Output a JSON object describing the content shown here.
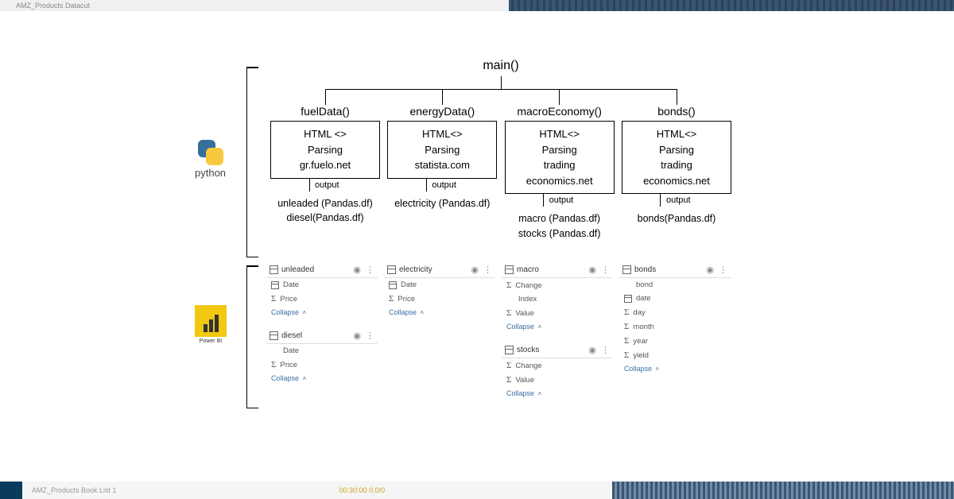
{
  "topbar": {
    "hint": "AMZ_Products Datacut"
  },
  "bottombar": {
    "label": "AMZ_Products Book List 1",
    "time": "00:30:00      0.0/0"
  },
  "tools": {
    "python": "python",
    "powerbi": "Power BI"
  },
  "diagram": {
    "main": "main()",
    "outputLabel": "output",
    "cols": [
      {
        "fn": "fuelData()",
        "box": [
          "HTML <>",
          "Parsing",
          "gr.fuelo.net"
        ],
        "outputs": [
          "unleaded (Pandas.df)",
          "diesel(Pandas.df)"
        ]
      },
      {
        "fn": "energyData()",
        "box": [
          "HTML<>",
          "Parsing",
          "statista.com"
        ],
        "outputs": [
          "electricity (Pandas.df)"
        ]
      },
      {
        "fn": "macroEconomy()",
        "box": [
          "HTML<>",
          "Parsing",
          "trading",
          "economics.net"
        ],
        "outputs": [
          "macro (Pandas.df)",
          "stocks (Pandas.df)"
        ]
      },
      {
        "fn": "bonds()",
        "box": [
          "HTML<>",
          "Parsing",
          "trading",
          "economics.net"
        ],
        "outputs": [
          "bonds(Pandas.df)"
        ]
      }
    ]
  },
  "tables": {
    "collapse": "Collapse",
    "eye": "◉",
    "more": "⋮",
    "cards": {
      "unleaded": {
        "name": "unleaded",
        "fields": [
          {
            "t": "cal",
            "n": "Date"
          },
          {
            "t": "sigma",
            "n": "Price"
          }
        ]
      },
      "diesel": {
        "name": "diesel",
        "fields": [
          {
            "t": "none",
            "n": "Date"
          },
          {
            "t": "sigma",
            "n": "Price"
          }
        ]
      },
      "electricity": {
        "name": "electricity",
        "fields": [
          {
            "t": "cal",
            "n": "Date"
          },
          {
            "t": "sigma",
            "n": "Price"
          }
        ]
      },
      "macro": {
        "name": "macro",
        "fields": [
          {
            "t": "sigma",
            "n": "Change"
          },
          {
            "t": "none",
            "n": "Index"
          },
          {
            "t": "sigma",
            "n": "Value"
          }
        ]
      },
      "stocks": {
        "name": "stocks",
        "fields": [
          {
            "t": "sigma",
            "n": "Change"
          },
          {
            "t": "sigma",
            "n": "Value"
          }
        ]
      },
      "bonds": {
        "name": "bonds",
        "fields": [
          {
            "t": "none",
            "n": "bond"
          },
          {
            "t": "cal",
            "n": "date"
          },
          {
            "t": "sigma",
            "n": "day"
          },
          {
            "t": "sigma",
            "n": "month"
          },
          {
            "t": "sigma",
            "n": "year"
          },
          {
            "t": "sigma",
            "n": "yield"
          }
        ]
      }
    }
  }
}
